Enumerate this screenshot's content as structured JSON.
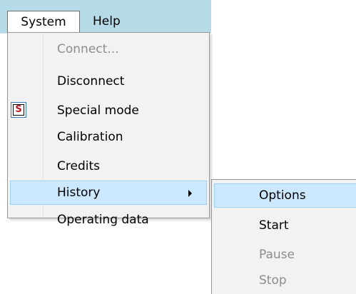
{
  "menubar": {
    "items": [
      {
        "label": "System"
      },
      {
        "label": "Help"
      }
    ]
  },
  "system_menu": {
    "items": [
      {
        "label": "Connect...",
        "enabled": false
      },
      {
        "label": "Disconnect",
        "enabled": true
      },
      {
        "label": "Special mode",
        "enabled": true,
        "icon": "special-mode-s-icon",
        "icon_letter": "S"
      },
      {
        "label": "Calibration",
        "enabled": true
      },
      {
        "label": "Credits",
        "enabled": true
      },
      {
        "label": "History",
        "enabled": true,
        "highlighted": true,
        "has_submenu": true
      },
      {
        "label": "Operating data",
        "enabled": true
      }
    ]
  },
  "history_submenu": {
    "items": [
      {
        "label": "Options",
        "enabled": true,
        "highlighted": true
      },
      {
        "label": "Start",
        "enabled": true
      },
      {
        "label": "Pause",
        "enabled": false
      },
      {
        "label": "Stop",
        "enabled": false
      }
    ]
  },
  "colors": {
    "menubar_bg": "#b5dae8",
    "menu_bg": "#f2f2f2",
    "highlight_bg": "#cce8ff",
    "highlight_border": "#99d1ff",
    "disabled_text": "#8d8d8d",
    "icon_letter": "#c0141c"
  }
}
